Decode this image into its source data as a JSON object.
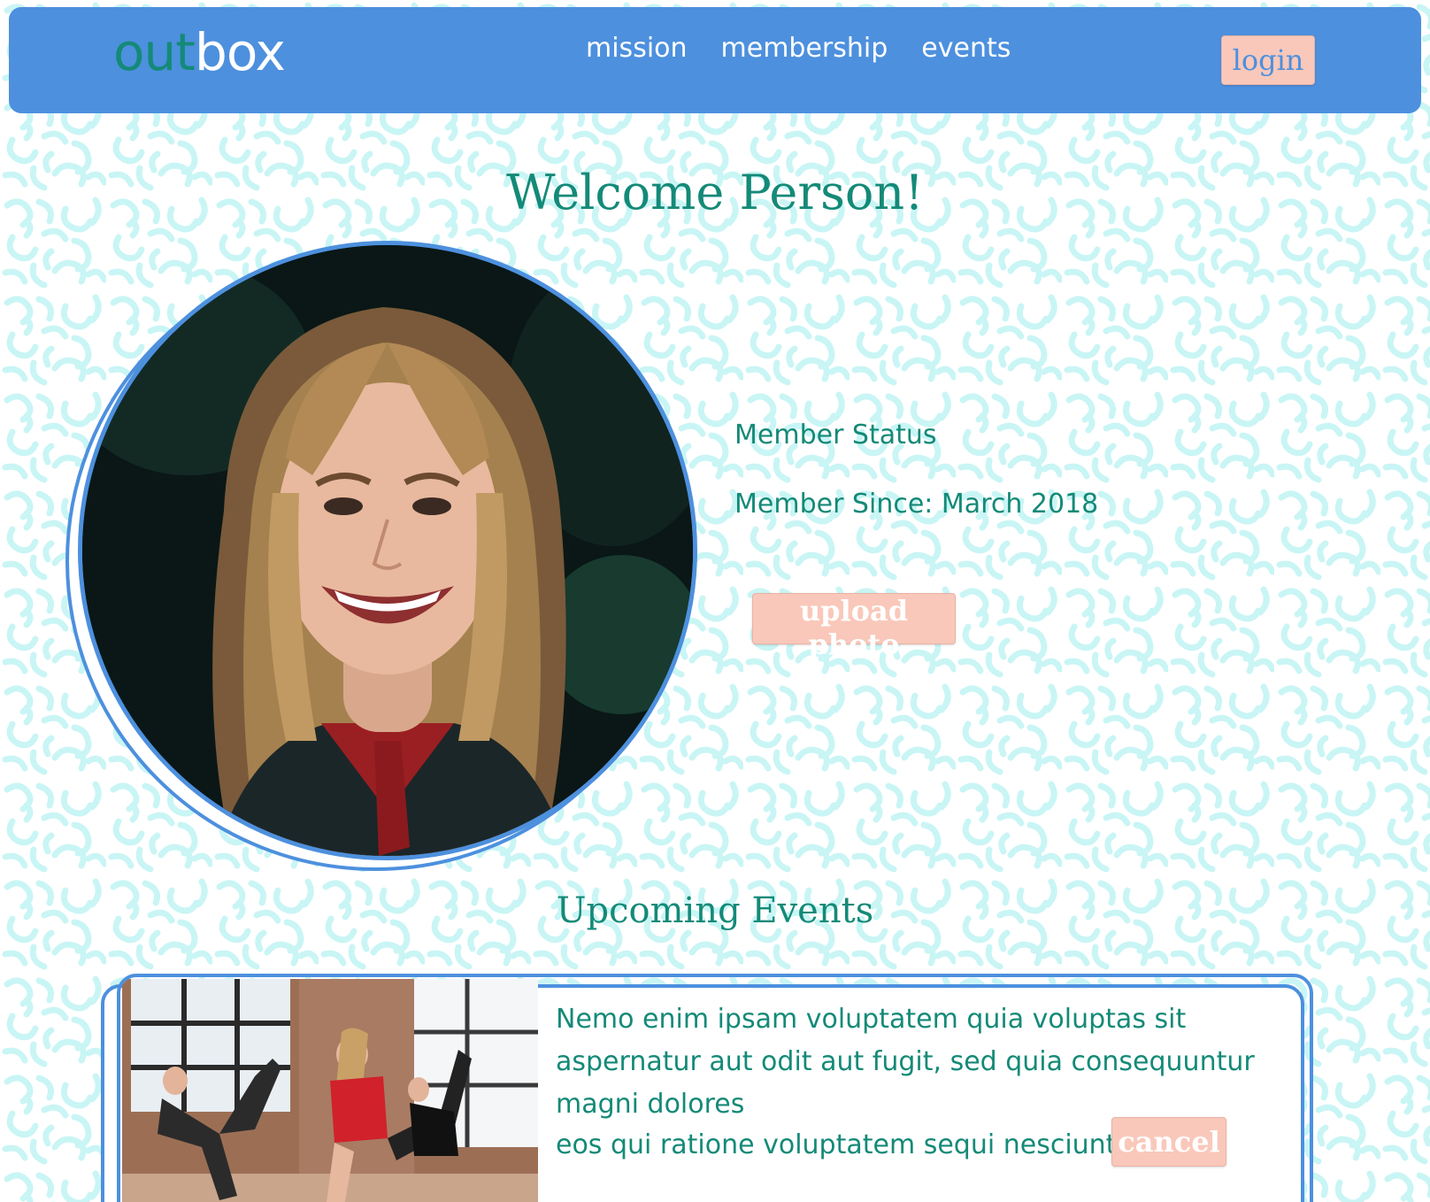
{
  "colors": {
    "navbar": "#4d90de",
    "accent_teal": "#148a78",
    "button_pink": "#f9c8ba",
    "pattern": "#c9f5f5"
  },
  "brand": {
    "logo_part1": "out",
    "logo_part2": "box"
  },
  "nav": {
    "links": [
      "mission",
      "membership",
      "events"
    ],
    "login_label": "login"
  },
  "profile": {
    "welcome": "Welcome Person!",
    "member_status": "Member Status",
    "member_since": "Member Since: March 2018",
    "upload_label": "upload photo"
  },
  "events": {
    "heading": "Upcoming Events",
    "items": [
      {
        "description_line1": "Nemo enim ipsam voluptatem quia voluptas sit aspernatur aut odit aut fugit, sed quia consequuntur magni dolores",
        "description_line2": "eos qui ratione voluptatem sequi nesciunt.",
        "cancel_label": "cancel"
      }
    ]
  }
}
